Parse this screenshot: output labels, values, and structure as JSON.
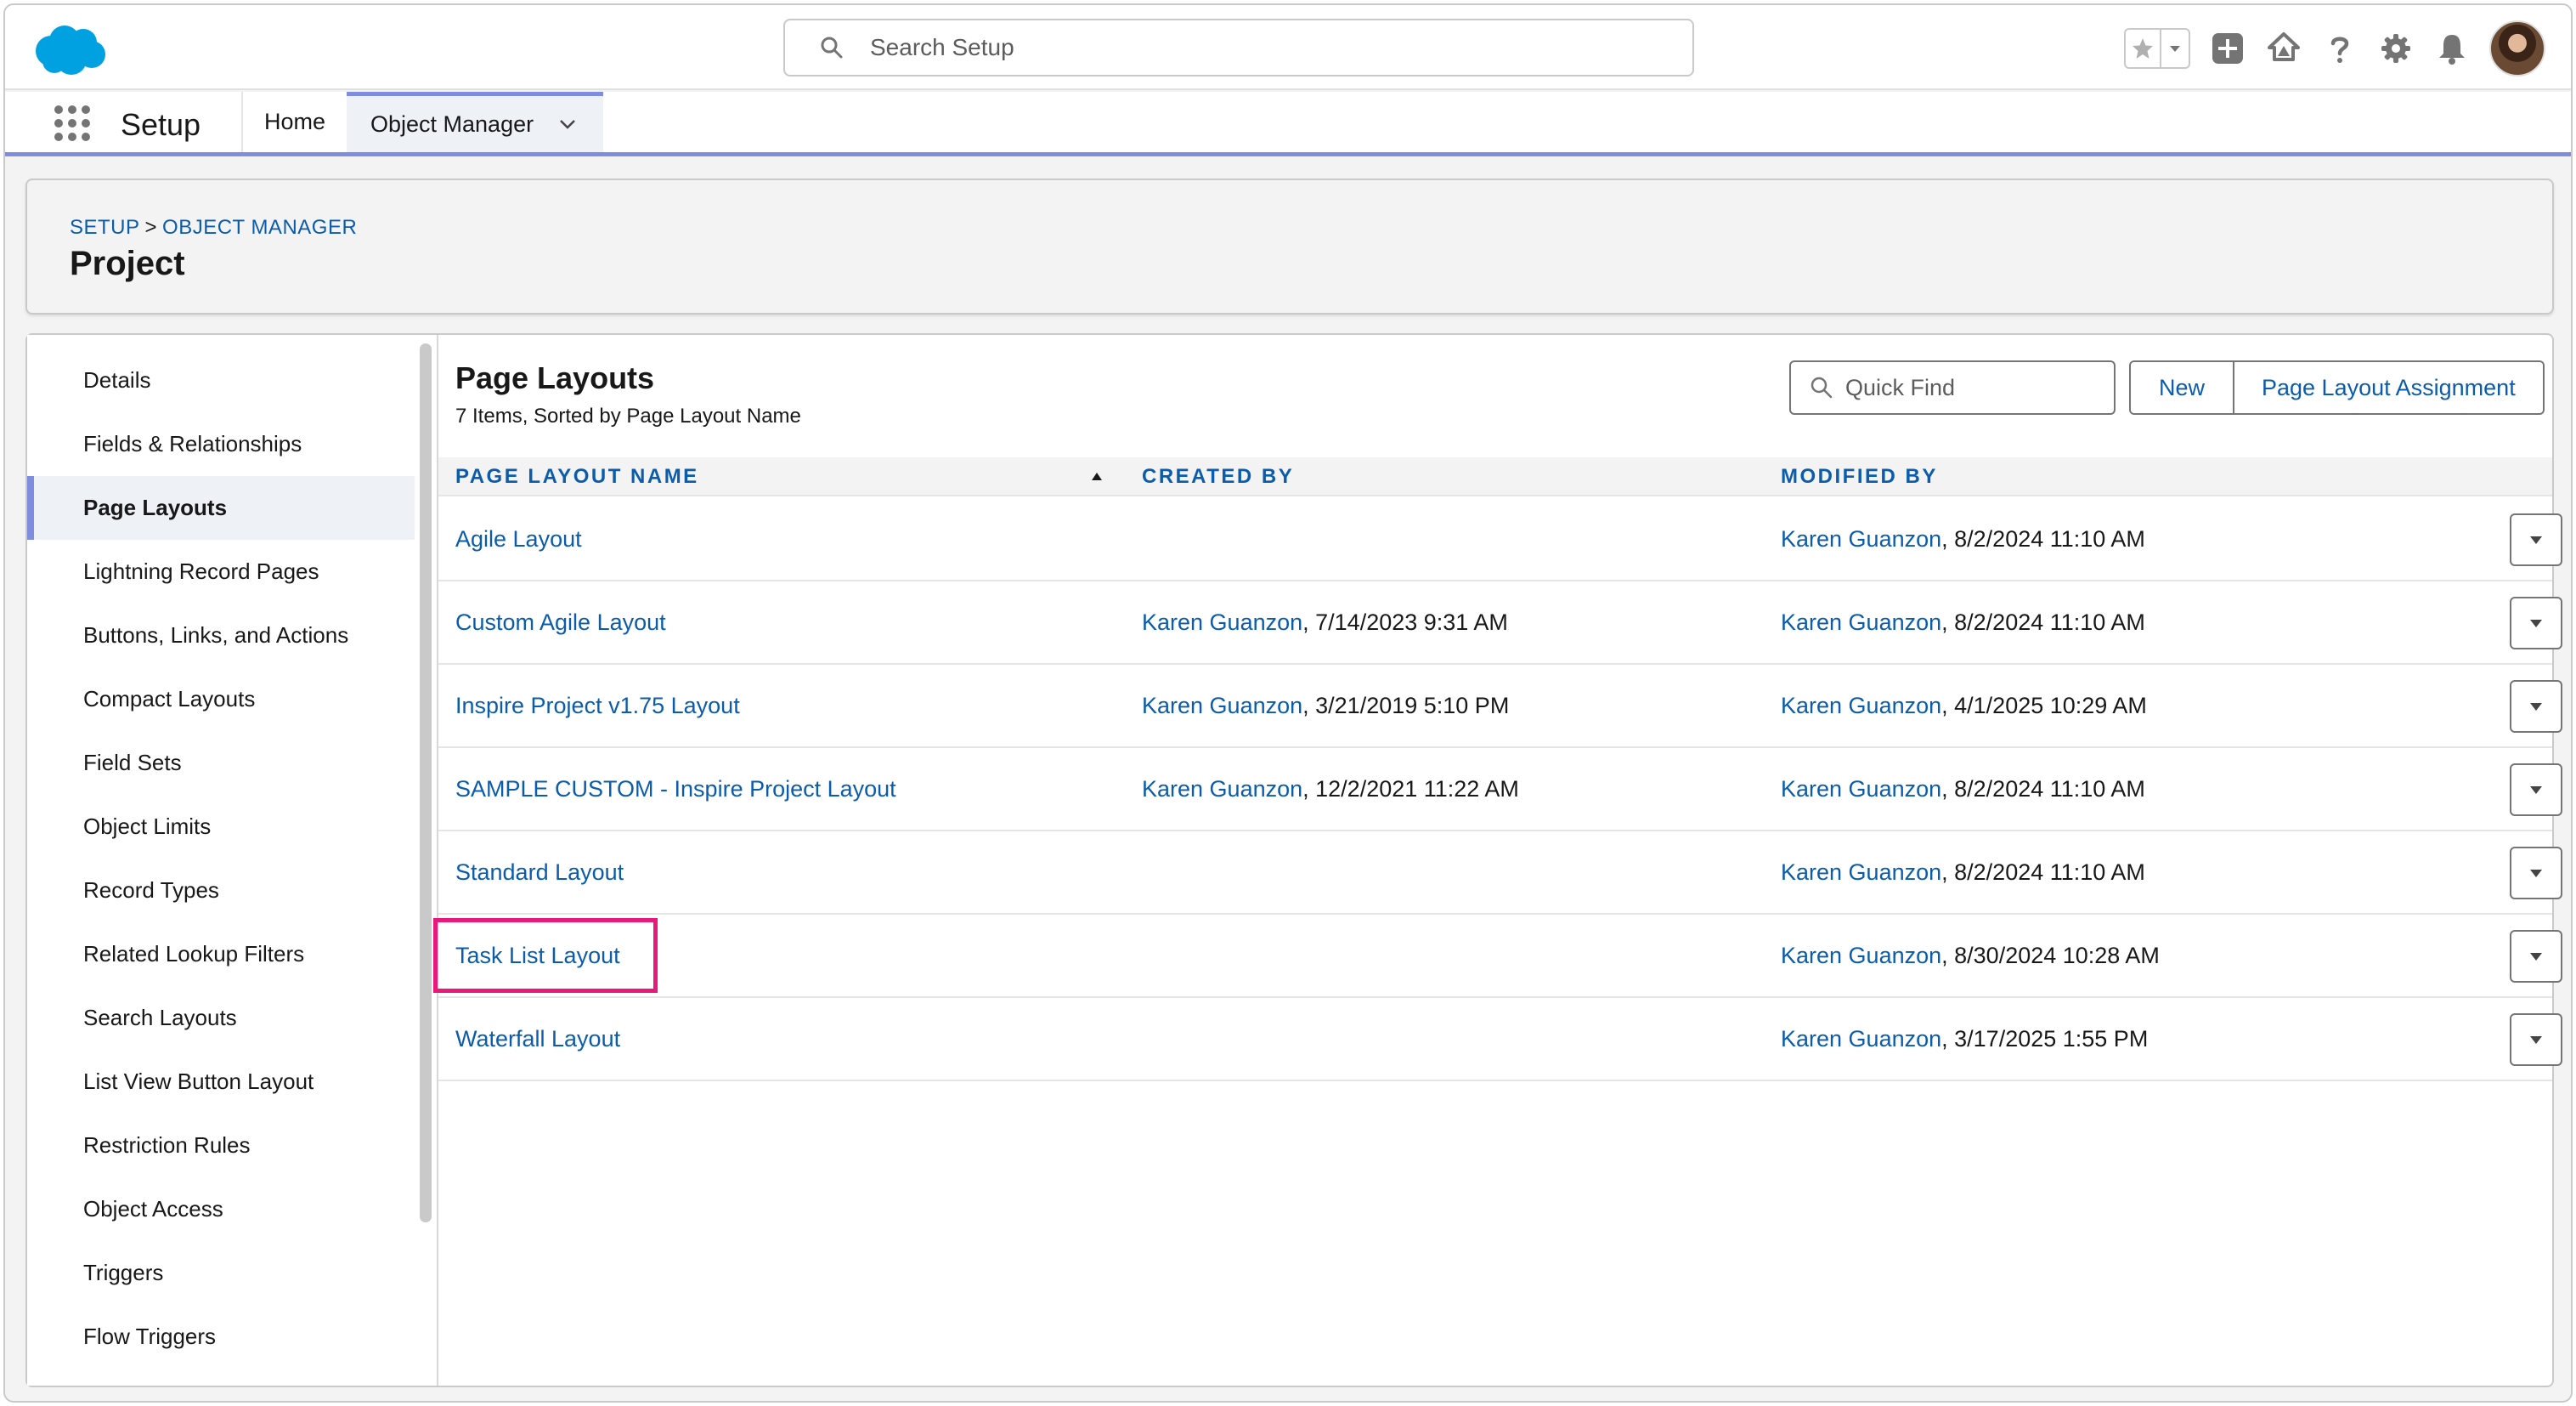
{
  "header": {
    "search_placeholder": "Search Setup",
    "icons": [
      "salesforce-cloud-logo",
      "search-icon",
      "star-icon",
      "chevron-down-icon",
      "add-icon",
      "trailhead-icon",
      "help-icon",
      "gear-icon",
      "bell-icon",
      "avatar"
    ]
  },
  "nav": {
    "app_name": "Setup",
    "tabs": [
      {
        "label": "Home"
      },
      {
        "label": "Object Manager",
        "active": true
      }
    ]
  },
  "page_header": {
    "breadcrumb_setup": "SETUP",
    "breadcrumb_sep": ">",
    "breadcrumb_object_manager": "OBJECT MANAGER",
    "title": "Project"
  },
  "sidebar": {
    "items": [
      {
        "label": "Details"
      },
      {
        "label": "Fields & Relationships"
      },
      {
        "label": "Page Layouts",
        "active": true
      },
      {
        "label": "Lightning Record Pages"
      },
      {
        "label": "Buttons, Links, and Actions"
      },
      {
        "label": "Compact Layouts"
      },
      {
        "label": "Field Sets"
      },
      {
        "label": "Object Limits"
      },
      {
        "label": "Record Types"
      },
      {
        "label": "Related Lookup Filters"
      },
      {
        "label": "Search Layouts"
      },
      {
        "label": "List View Button Layout"
      },
      {
        "label": "Restriction Rules"
      },
      {
        "label": "Object Access"
      },
      {
        "label": "Triggers"
      },
      {
        "label": "Flow Triggers"
      }
    ]
  },
  "content": {
    "title": "Page Layouts",
    "subtitle": "7 Items, Sorted by Page Layout Name",
    "quick_find_placeholder": "Quick Find",
    "new_label": "New",
    "assignment_label": "Page Layout Assignment",
    "columns": {
      "name": "PAGE LAYOUT NAME",
      "created_by": "CREATED BY",
      "modified_by": "MODIFIED BY"
    },
    "rows": [
      {
        "name": "Agile Layout",
        "created_user": "",
        "created_date": "",
        "modified_user": "Karen Guanzon",
        "modified_date": ", 8/2/2024 11:10 AM"
      },
      {
        "name": "Custom Agile Layout",
        "created_user": "Karen Guanzon",
        "created_date": ", 7/14/2023 9:31 AM",
        "modified_user": "Karen Guanzon",
        "modified_date": ", 8/2/2024 11:10 AM"
      },
      {
        "name": "Inspire Project v1.75 Layout",
        "created_user": "Karen Guanzon",
        "created_date": ", 3/21/2019 5:10 PM",
        "modified_user": "Karen Guanzon",
        "modified_date": ", 4/1/2025 10:29 AM"
      },
      {
        "name": "SAMPLE CUSTOM - Inspire Project Layout",
        "created_user": "Karen Guanzon",
        "created_date": ", 12/2/2021 11:22 AM",
        "modified_user": "Karen Guanzon",
        "modified_date": ", 8/2/2024 11:10 AM"
      },
      {
        "name": "Standard Layout",
        "created_user": "",
        "created_date": "",
        "modified_user": "Karen Guanzon",
        "modified_date": ", 8/2/2024 11:10 AM"
      },
      {
        "name": "Task List Layout",
        "created_user": "",
        "created_date": "",
        "modified_user": "Karen Guanzon",
        "modified_date": ", 8/30/2024 10:28 AM",
        "highlighted": true
      },
      {
        "name": "Waterfall Layout",
        "created_user": "",
        "created_date": "",
        "modified_user": "Karen Guanzon",
        "modified_date": ", 3/17/2025 1:55 PM"
      }
    ]
  },
  "colors": {
    "link": "#0b5cab",
    "accent": "#7f8de1",
    "highlight": "#e8197a",
    "logo": "#00a1e0"
  }
}
